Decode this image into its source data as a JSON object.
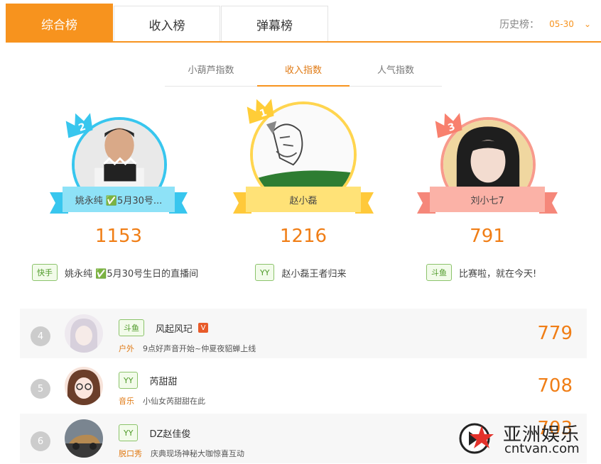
{
  "top_tabs": [
    {
      "label": "综合榜",
      "active": true
    },
    {
      "label": "收入榜",
      "active": false
    },
    {
      "label": "弹幕榜",
      "active": false
    }
  ],
  "history": {
    "label": "历史榜：",
    "date": "05-30"
  },
  "sub_tabs": [
    {
      "label": "小葫芦指数",
      "active": false
    },
    {
      "label": "收入指数",
      "active": true
    },
    {
      "label": "人气指数",
      "active": false
    }
  ],
  "podium": {
    "second": {
      "rank": "2",
      "name": "姚永纯 ✅5月30号...",
      "score": "1153",
      "platform": "快手",
      "room": "姚永纯 ✅5月30号生日的直播间"
    },
    "first": {
      "rank": "1",
      "name": "赵小磊",
      "score": "1216",
      "platform": "YY",
      "room": "赵小磊王者归来"
    },
    "third": {
      "rank": "3",
      "name": "刘小七7",
      "score": "791",
      "platform": "斗鱼",
      "room": "比赛啦，就在今天!"
    }
  },
  "list": [
    {
      "rank": "4",
      "platform": "斗鱼",
      "name": "风起风玘",
      "verified": "V",
      "category": "户外",
      "room": "9点好声音开始~仲夏夜貂蝉上线",
      "score": "779"
    },
    {
      "rank": "5",
      "platform": "YY",
      "name": "芮甜甜",
      "category": "音乐",
      "room": "小仙女芮甜甜在此",
      "score": "708"
    },
    {
      "rank": "6",
      "platform": "YY",
      "name": "DZ赵佳俊",
      "category": "脱口秀",
      "room": "庆典现场神秘大咖惊喜互动",
      "score": "703"
    }
  ],
  "watermark": {
    "title": "亚洲娱乐",
    "domain": "cntvan.com"
  },
  "colors": {
    "accent": "#f7931e",
    "score": "#f07e16",
    "second": "#38c6ee",
    "first": "#ffd54f",
    "third": "#f89a8c"
  }
}
